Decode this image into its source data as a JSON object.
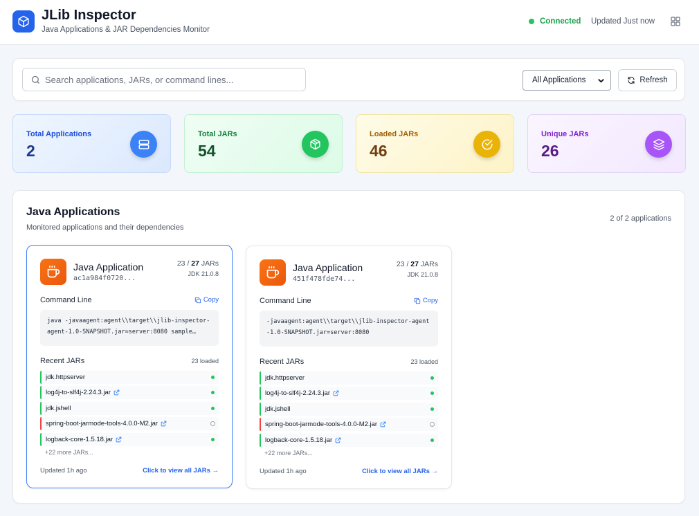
{
  "header": {
    "title": "JLib Inspector",
    "subtitle": "Java Applications & JAR Dependencies Monitor",
    "status": "Connected",
    "updated": "Updated Just now"
  },
  "toolbar": {
    "search_placeholder": "Search applications, JARs, or command lines...",
    "filter_value": "All Applications",
    "refresh_label": "Refresh"
  },
  "stats": [
    {
      "label": "Total Applications",
      "value": "2"
    },
    {
      "label": "Total JARs",
      "value": "54"
    },
    {
      "label": "Loaded JARs",
      "value": "46"
    },
    {
      "label": "Unique JARs",
      "value": "26"
    }
  ],
  "panel": {
    "title": "Java Applications",
    "subtitle": "Monitored applications and their dependencies",
    "count": "2 of 2 applications"
  },
  "apps": [
    {
      "name": "Java Application",
      "id": "ac1a984f0720...",
      "loaded_count": "23",
      "total_count": "27",
      "jars_word": "JARs",
      "jdk": "JDK 21.0.8",
      "command_label": "Command Line",
      "copy_label": "Copy",
      "command": "java -javaagent:agent\\\\target\\\\jlib-inspector-agent-1.0-SNAPSHOT.jar=server:8080 sample…",
      "recent_label": "Recent JARs",
      "recent_count": "23 loaded",
      "jars": [
        {
          "name": "jdk.httpserver",
          "loaded": true,
          "link": false
        },
        {
          "name": "log4j-to-slf4j-2.24.3.jar",
          "loaded": true,
          "link": true
        },
        {
          "name": "jdk.jshell",
          "loaded": true,
          "link": false
        },
        {
          "name": "spring-boot-jarmode-tools-4.0.0-M2.jar",
          "loaded": false,
          "link": true
        },
        {
          "name": "logback-core-1.5.18.jar",
          "loaded": true,
          "link": true
        }
      ],
      "more": "+22 more JARs...",
      "updated": "Updated 1h ago",
      "view_all": "Click to view all JARs →"
    },
    {
      "name": "Java Application",
      "id": "451f478fde74...",
      "loaded_count": "23",
      "total_count": "27",
      "jars_word": "JARs",
      "jdk": "JDK 21.0.8",
      "command_label": "Command Line",
      "copy_label": "Copy",
      "command": "-javaagent:agent\\\\target\\\\jlib-inspector-agent-1.0-SNAPSHOT.jar=server:8080",
      "recent_label": "Recent JARs",
      "recent_count": "23 loaded",
      "jars": [
        {
          "name": "jdk.httpserver",
          "loaded": true,
          "link": false
        },
        {
          "name": "log4j-to-slf4j-2.24.3.jar",
          "loaded": true,
          "link": true
        },
        {
          "name": "jdk.jshell",
          "loaded": true,
          "link": false
        },
        {
          "name": "spring-boot-jarmode-tools-4.0.0-M2.jar",
          "loaded": false,
          "link": true
        },
        {
          "name": "logback-core-1.5.18.jar",
          "loaded": true,
          "link": true
        }
      ],
      "more": "+22 more JARs...",
      "updated": "Updated 1h ago",
      "view_all": "Click to view all JARs →"
    }
  ]
}
